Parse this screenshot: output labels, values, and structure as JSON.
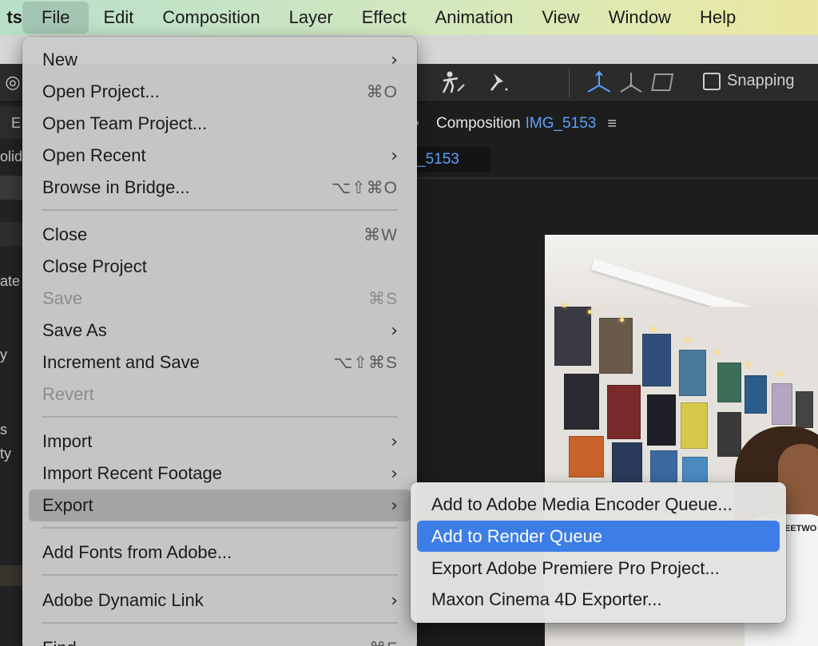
{
  "menubar": {
    "items": [
      {
        "label": "ts"
      },
      {
        "label": "File"
      },
      {
        "label": "Edit"
      },
      {
        "label": "Composition"
      },
      {
        "label": "Layer"
      },
      {
        "label": "Effect"
      },
      {
        "label": "Animation"
      },
      {
        "label": "View"
      },
      {
        "label": "Window"
      },
      {
        "label": "Help"
      }
    ]
  },
  "toolbar": {
    "snapping_label": "Snapping"
  },
  "left_panel": {
    "fragments": [
      "E",
      "olid",
      "ate",
      "y",
      "s",
      "ty"
    ]
  },
  "composition": {
    "title": "Composition",
    "name": "IMG_5153",
    "tab_label": "_5153",
    "shirt_text": "EETWO"
  },
  "file_menu": {
    "items": [
      {
        "label": "New",
        "shortcut": "",
        "submenu": true
      },
      {
        "label": "Open Project...",
        "shortcut": "⌘O"
      },
      {
        "label": "Open Team Project...",
        "shortcut": ""
      },
      {
        "label": "Open Recent",
        "shortcut": "",
        "submenu": true
      },
      {
        "label": "Browse in Bridge...",
        "shortcut": "⌥⇧⌘O"
      },
      {
        "label": "Close",
        "shortcut": "⌘W"
      },
      {
        "label": "Close Project",
        "shortcut": ""
      },
      {
        "label": "Save",
        "shortcut": "⌘S",
        "disabled": true
      },
      {
        "label": "Save As",
        "shortcut": "",
        "submenu": true
      },
      {
        "label": "Increment and Save",
        "shortcut": "⌥⇧⌘S"
      },
      {
        "label": "Revert",
        "shortcut": "",
        "disabled": true
      },
      {
        "label": "Import",
        "shortcut": "",
        "submenu": true
      },
      {
        "label": "Import Recent Footage",
        "shortcut": "",
        "submenu": true
      },
      {
        "label": "Export",
        "shortcut": "",
        "submenu": true,
        "highlighted": true
      },
      {
        "label": "Add Fonts from Adobe...",
        "shortcut": ""
      },
      {
        "label": "Adobe Dynamic Link",
        "shortcut": "",
        "submenu": true
      },
      {
        "label": "Find",
        "shortcut": "⌘F"
      }
    ]
  },
  "export_submenu": {
    "items": [
      {
        "label": "Add to Adobe Media Encoder Queue..."
      },
      {
        "label": "Add to Render Queue",
        "selected": true
      },
      {
        "label": "Export Adobe Premiere Pro Project..."
      },
      {
        "label": "Maxon Cinema 4D Exporter..."
      }
    ]
  },
  "colors": {
    "selection": "#3d7de6",
    "link_blue": "#5aa2ff"
  },
  "icons": {
    "submenu_arrow": "chevron-right-icon"
  }
}
